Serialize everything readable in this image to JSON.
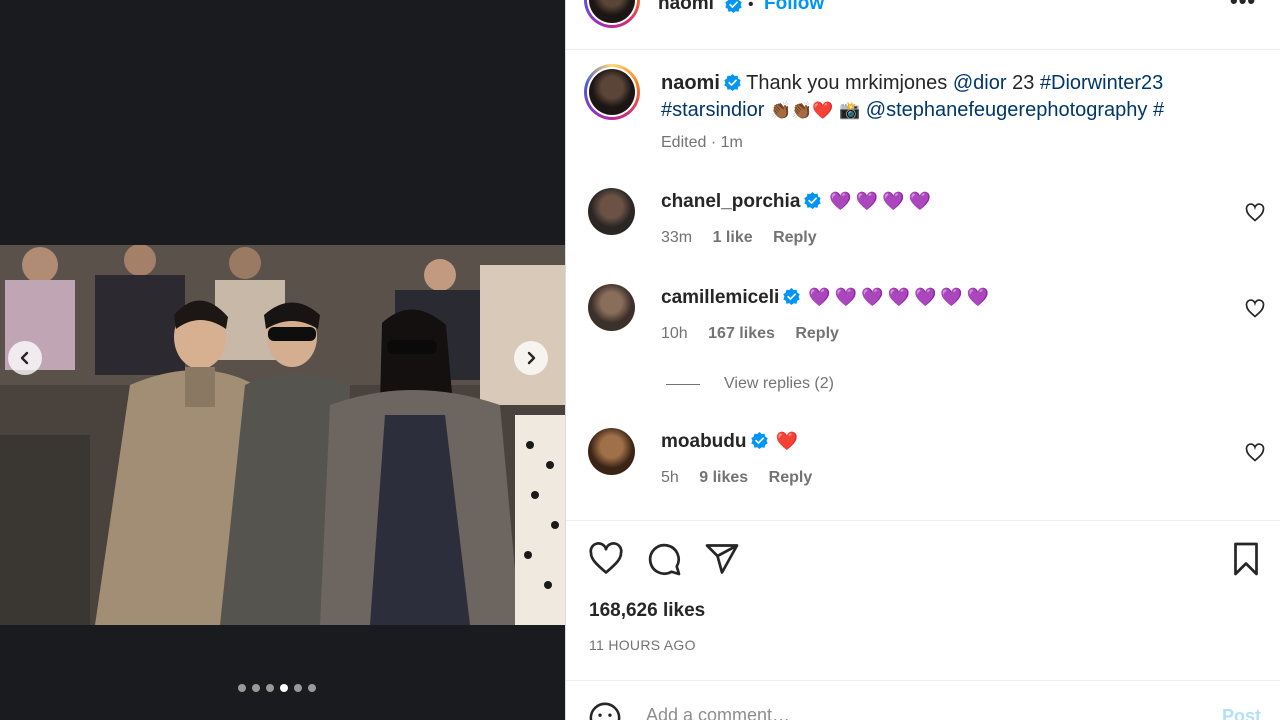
{
  "header": {
    "username": "naomi",
    "separator": "•",
    "follow_label": "Follow",
    "more_label": "•••"
  },
  "caption": {
    "username": "naomi",
    "text_1": "Thank you mrkimjones",
    "mention_1": "@dior",
    "num": "23",
    "hashtag_1": "#Diorwinter23",
    "hashtag_2": "#starsindior",
    "emojis": "👏🏾👏🏾❤️",
    "camera": "📸",
    "mention_2": "@stephanefeugerephotography",
    "trailing": "#",
    "edited": "Edited · 1m"
  },
  "comments": [
    {
      "username": "chanel_porchia",
      "text": "💜💜💜💜",
      "time": "33m",
      "likes": "1 like",
      "reply": "Reply",
      "avatar_color": "#2b2624"
    },
    {
      "username": "camillemiceli",
      "text": "💜💜💜💜💜💜💜",
      "time": "10h",
      "likes": "167 likes",
      "reply": "Reply",
      "avatar_color": "#5a4a40"
    },
    {
      "username": "moabudu",
      "text": "❤️",
      "time": "5h",
      "likes": "9 likes",
      "reply": "Reply",
      "avatar_color": "#7a5232"
    }
  ],
  "view_replies": "View replies (2)",
  "post_likes": "168,626 likes",
  "post_time": "11 HOURS AGO",
  "comment_bar": {
    "placeholder": "Add a comment…",
    "post_label": "Post"
  },
  "carousel": {
    "count": 6,
    "active_index": 3
  },
  "colors": {
    "link": "#00376b",
    "follow": "#0095f6",
    "verified": "#0095f6",
    "muted": "#737373"
  }
}
